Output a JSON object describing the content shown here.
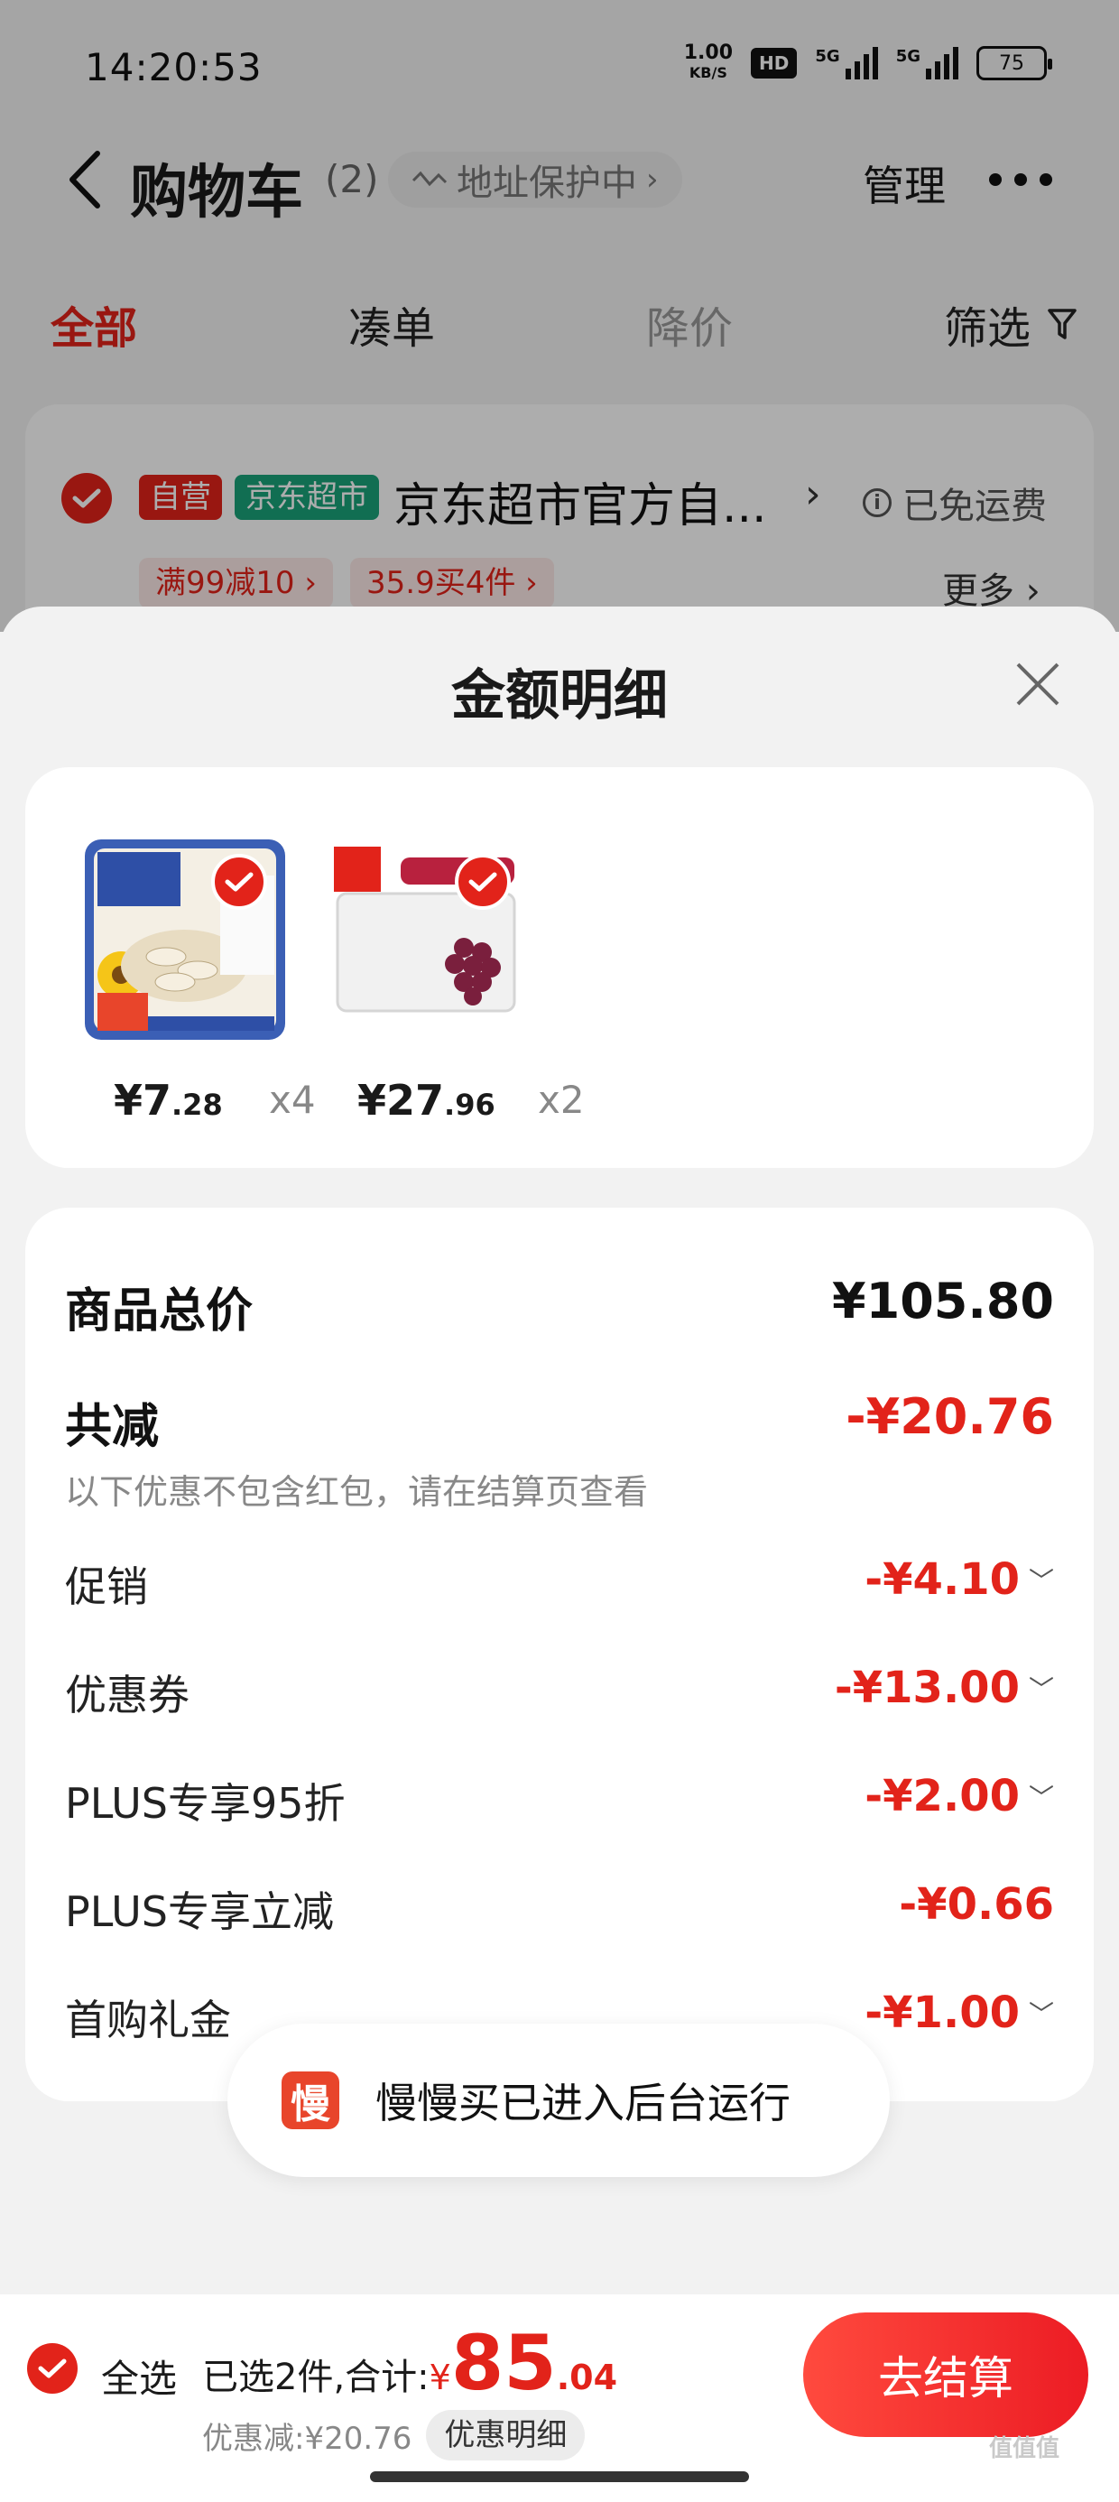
{
  "status_bar": {
    "time": "14:20:53",
    "net_speed_value": "1.00",
    "net_speed_unit": "KB/S",
    "hd_label": "HD",
    "signal1_label": "5G",
    "signal2_label": "5G",
    "battery": "75"
  },
  "header": {
    "title": "购物车",
    "count": "(2)",
    "address_protect": "地址保护中",
    "manage": "管理"
  },
  "tabs": [
    {
      "label": "全部"
    },
    {
      "label": "凑单"
    },
    {
      "label": "降价"
    },
    {
      "label": "筛选"
    }
  ],
  "store": {
    "tag_self": "自营",
    "tag_market": "京东超市",
    "name": "京东超市官方自...",
    "shipping": "已免运费",
    "promos": [
      "满99减10 ›",
      "35.9买4件 ›"
    ],
    "more": "更多 ›"
  },
  "sheet": {
    "title": "金额明细",
    "products": [
      {
        "price_int": "¥7",
        "price_dec": ".28",
        "qty": "x4"
      },
      {
        "price_int": "¥27",
        "price_dec": ".96",
        "qty": "x2"
      }
    ],
    "total_label": "商品总价",
    "total_value": "¥105.80",
    "reduce_label": "共减",
    "reduce_value": "-¥20.76",
    "reduce_note": "以下优惠不包含红包，请在结算页查看",
    "discounts": [
      {
        "label": "促销",
        "value": "-¥4.10"
      },
      {
        "label": "优惠券",
        "value": "-¥13.00"
      },
      {
        "label": "PLUS专享95折",
        "value": "-¥2.00"
      },
      {
        "label": "PLUS专享立减",
        "value": "-¥0.66"
      },
      {
        "label": "首购礼金",
        "value": "-¥1.00"
      }
    ]
  },
  "toast": {
    "icon_char": "慢",
    "text": "慢慢买已进入后台运行"
  },
  "footer": {
    "select_all": "全选",
    "selected_text": "已选2件,合计:",
    "total_yen": "¥",
    "total_int": "85",
    "total_dec": ".04",
    "discount_text": "优惠减:¥20.76",
    "detail_button": "优惠明细",
    "checkout": "去结算"
  },
  "watermark": "值值值",
  "colors": {
    "accent": "#e2231a",
    "market_green": "#1aa37a"
  }
}
